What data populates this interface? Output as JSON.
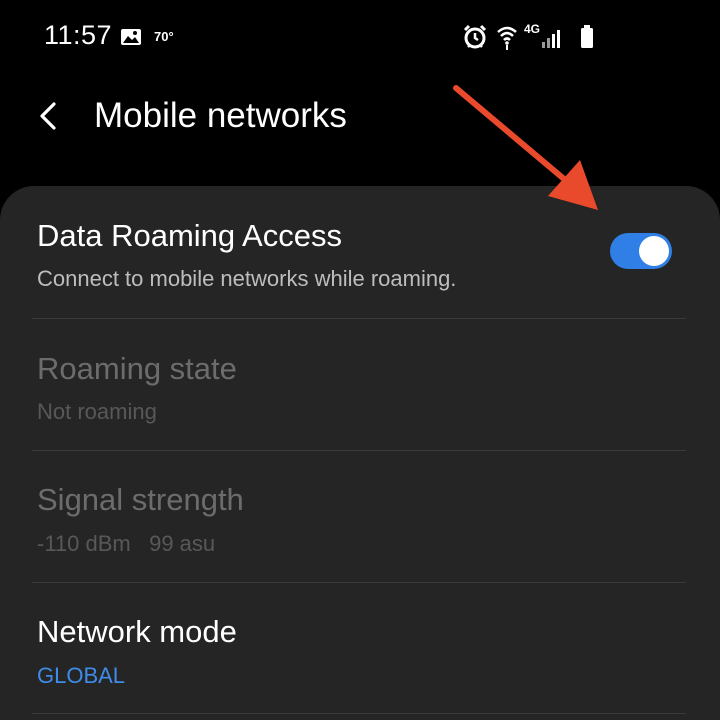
{
  "status_bar": {
    "time": "11:57",
    "temperature": "70°",
    "network_type": "4G",
    "icons": [
      "gallery-icon",
      "alarm-icon",
      "wifi-icon",
      "signal-icon",
      "battery-icon"
    ]
  },
  "header": {
    "title": "Mobile networks",
    "back_icon": "chevron-left-icon"
  },
  "settings": [
    {
      "title": "Data Roaming Access",
      "subtitle": "Connect to mobile networks while roaming.",
      "enabled": true,
      "toggle_on": true
    },
    {
      "title": "Roaming state",
      "subtitle": "Not roaming",
      "enabled": false
    },
    {
      "title": "Signal strength",
      "subtitle": "-110 dBm   99 asu",
      "enabled": false
    },
    {
      "title": "Network mode",
      "subtitle": "GLOBAL",
      "enabled": true
    }
  ],
  "colors": {
    "background": "#000000",
    "card": "#252525",
    "text_primary": "#ffffff",
    "text_secondary": "#bdbdbd",
    "text_disabled": "#6c6c6c",
    "accent_blue": "#3e8be8",
    "toggle_on": "#2f7fe6",
    "annotation_arrow": "#ea4a2c"
  }
}
